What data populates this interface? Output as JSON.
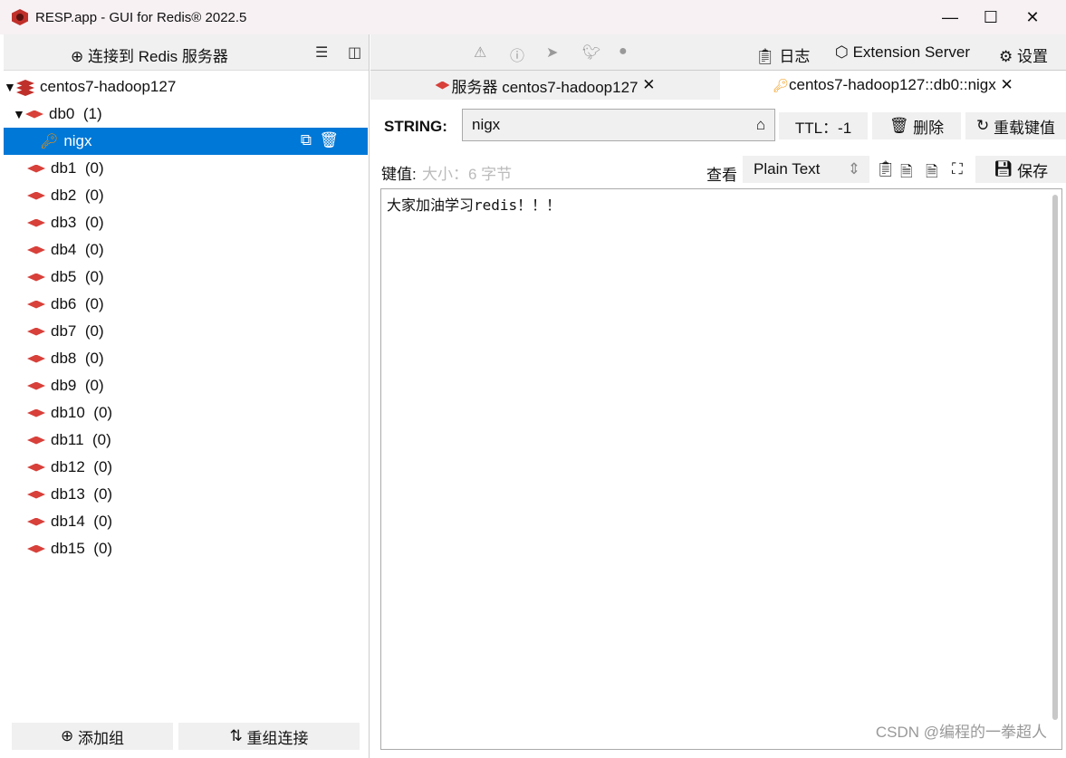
{
  "window": {
    "title": "RESP.app - GUI for Redis® 2022.5",
    "minimize": "—",
    "maximize": "☐",
    "close": "✕"
  },
  "sidebar": {
    "connect_label": "连接到 Redis 服务器",
    "server": "centos7-hadoop127",
    "db0": {
      "name": "db0",
      "count": "(1)"
    },
    "selected_key": "nigx",
    "dbs": [
      {
        "name": "db1",
        "count": "(0)"
      },
      {
        "name": "db2",
        "count": "(0)"
      },
      {
        "name": "db3",
        "count": "(0)"
      },
      {
        "name": "db4",
        "count": "(0)"
      },
      {
        "name": "db5",
        "count": "(0)"
      },
      {
        "name": "db6",
        "count": "(0)"
      },
      {
        "name": "db7",
        "count": "(0)"
      },
      {
        "name": "db8",
        "count": "(0)"
      },
      {
        "name": "db9",
        "count": "(0)"
      },
      {
        "name": "db10",
        "count": "(0)"
      },
      {
        "name": "db11",
        "count": "(0)"
      },
      {
        "name": "db12",
        "count": "(0)"
      },
      {
        "name": "db13",
        "count": "(0)"
      },
      {
        "name": "db14",
        "count": "(0)"
      },
      {
        "name": "db15",
        "count": "(0)"
      }
    ],
    "add_group": "添加组",
    "regroup": "重组连接"
  },
  "toolbar": {
    "log": "日志",
    "extension": "Extension Server",
    "settings": "设置"
  },
  "tabs": [
    {
      "label": "服务器 centos7-hadoop127"
    },
    {
      "label": "centos7-hadoop127::db0::nigx"
    }
  ],
  "key_view": {
    "type_label": "STRING:",
    "key_name": "nigx",
    "ttl": "TTL：-1",
    "delete": "删除",
    "reload": "重载键值",
    "value_label": "键值:",
    "size": "大小：6 字节",
    "view_label": "查看",
    "format": "Plain Text",
    "save": "保存",
    "value": "大家加油学习redis！！！"
  },
  "watermark": "CSDN @编程的一拳超人",
  "colors": {
    "selection": "#0078d7",
    "redis_red": "#d8403a",
    "key_orange": "#f0940a"
  }
}
